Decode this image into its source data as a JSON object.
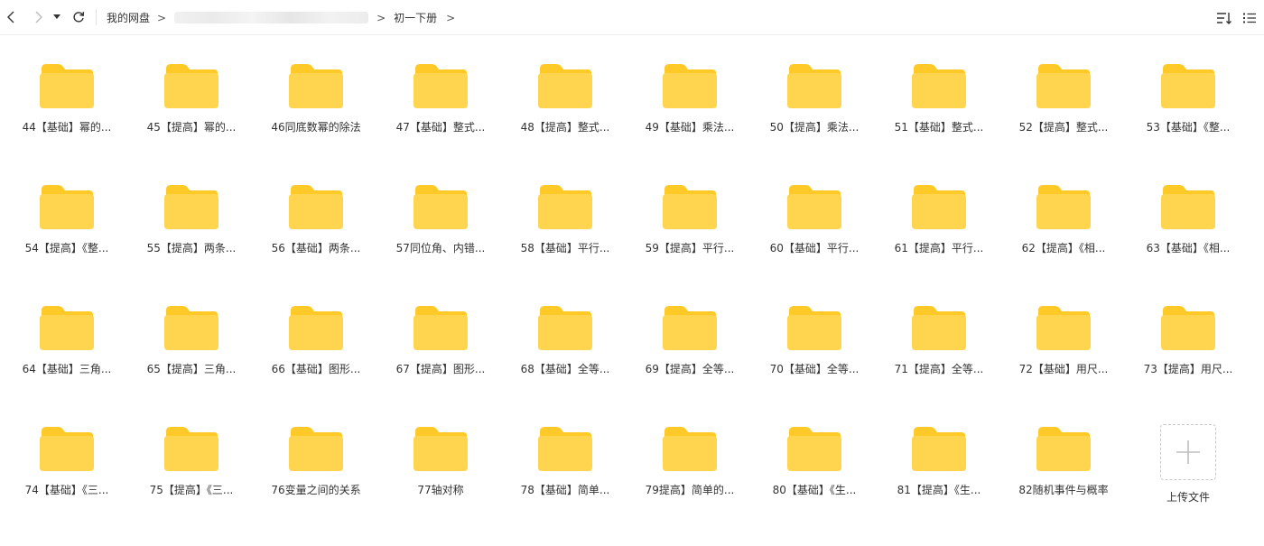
{
  "breadcrumb": {
    "root": "我的网盘",
    "current": "初一下册",
    "separator": ">"
  },
  "colors": {
    "folder_body": "#FFD54F",
    "folder_tab": "#FFC928",
    "folder_shadow": "#F7C132"
  },
  "folders": [
    "44【基础】幂的...",
    "45【提高】幂的...",
    "46同底数幂的除法",
    "47【基础】整式...",
    "48【提高】整式...",
    "49【基础】乘法...",
    "50【提高】乘法...",
    "51【基础】整式...",
    "52【提高】整式...",
    "53【基础】《整...",
    "54【提高】《整...",
    "55【提高】两条...",
    "56【基础】两条...",
    "57同位角、内错...",
    "58【基础】平行...",
    "59【提高】平行...",
    "60【基础】平行...",
    "61【提高】平行...",
    "62【提高】《相...",
    "63【基础】《相...",
    "64【基础】三角...",
    "65【提高】三角...",
    "66【基础】图形...",
    "67【提高】图形...",
    "68【基础】全等...",
    "69【提高】全等...",
    "70【基础】全等...",
    "71【提高】全等...",
    "72【基础】用尺...",
    "73【提高】用尺...",
    "74【基础】《三...",
    "75【提高】《三...",
    "76变量之间的关系",
    "77轴对称",
    "78【基础】简单...",
    "79提高】简单的...",
    "80【基础】《生...",
    "81【提高】《生...",
    "82随机事件与概率"
  ],
  "upload": {
    "label": "上传文件"
  },
  "icons": {
    "back": "chevron-left-icon",
    "forward": "chevron-right-icon",
    "dropdown": "caret-down-icon",
    "refresh": "refresh-icon",
    "sort": "sort-icon",
    "view": "list-view-icon",
    "upload": "plus-icon",
    "folder": "folder-icon"
  }
}
